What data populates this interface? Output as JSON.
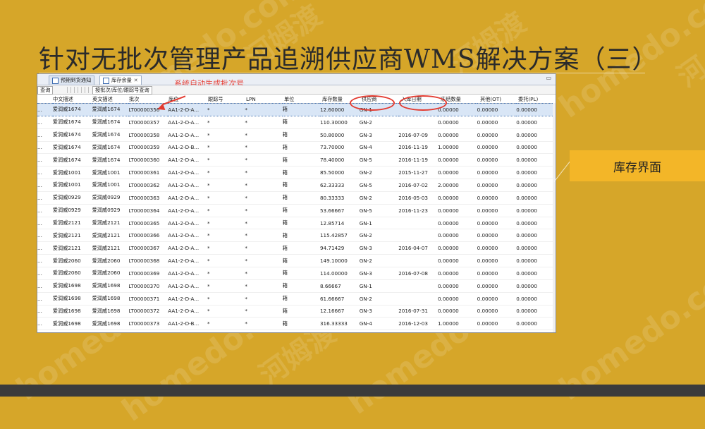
{
  "slide": {
    "title": "针对无批次管理产品追溯供应商WMS解决方案（三）",
    "callout": "库存界面",
    "annotation": "系统自动生成批次号",
    "watermarks": [
      "homedo.com",
      "河姆渡",
      "homedo.com",
      "河姆渡",
      "homedo.com",
      "homedo.com",
      "河姆渡",
      "homedo.com",
      "homedo.com",
      "河"
    ]
  },
  "window": {
    "tabs": [
      {
        "label": "预期到货通知",
        "active": false
      },
      {
        "label": "库存余量",
        "active": true
      }
    ],
    "tab_close": "✕",
    "minimize": "▭",
    "subtabs": [
      "查询",
      "按批次/库位/跟踪号查询"
    ]
  },
  "grid": {
    "columns": [
      "中文描述",
      "英文描述",
      "批次",
      "库位",
      "跟踪号",
      "LPN",
      "单位",
      "库存数量",
      "供应商",
      "入库日期",
      "冻结数量",
      "其他(OT)",
      "委托(PL)"
    ],
    "rows": [
      [
        "...",
        "爱润威1674",
        "爱润威1674",
        "LT00000356",
        "AA1-2-D-A...",
        "*",
        "*",
        "箱",
        "12.60000",
        "GN-1",
        "",
        "0.00000",
        "0.00000",
        "0.00000"
      ],
      [
        "...",
        "爱润威1674",
        "爱润威1674",
        "LT00000357",
        "AA1-2-D-A...",
        "*",
        "*",
        "箱",
        "110.30000",
        "GN-2",
        "",
        "0.00000",
        "0.00000",
        "0.00000"
      ],
      [
        "...",
        "爱润威1674",
        "爱润威1674",
        "LT00000358",
        "AA1-2-D-A...",
        "*",
        "*",
        "箱",
        "50.80000",
        "GN-3",
        "2016-07-09",
        "0.00000",
        "0.00000",
        "0.00000"
      ],
      [
        "...",
        "爱润威1674",
        "爱润威1674",
        "LT00000359",
        "AA1-2-D-B...",
        "*",
        "*",
        "箱",
        "73.70000",
        "GN-4",
        "2016-11-19",
        "1.00000",
        "0.00000",
        "0.00000"
      ],
      [
        "...",
        "爱润威1674",
        "爱润威1674",
        "LT00000360",
        "AA1-2-D-A...",
        "*",
        "*",
        "箱",
        "78.40000",
        "GN-5",
        "2016-11-19",
        "0.00000",
        "0.00000",
        "0.00000"
      ],
      [
        "...",
        "爱润威1001",
        "爱润威1001",
        "LT00000361",
        "AA1-2-D-A...",
        "*",
        "*",
        "箱",
        "85.50000",
        "GN-2",
        "2015-11-27",
        "0.00000",
        "0.00000",
        "0.00000"
      ],
      [
        "...",
        "爱润威1001",
        "爱润威1001",
        "LT00000362",
        "AA1-2-D-A...",
        "*",
        "*",
        "箱",
        "62.33333",
        "GN-5",
        "2016-07-02",
        "2.00000",
        "0.00000",
        "0.00000"
      ],
      [
        "...",
        "爱润威0929",
        "爱润威0929",
        "LT00000363",
        "AA1-2-D-A...",
        "*",
        "*",
        "箱",
        "80.33333",
        "GN-2",
        "2016-05-03",
        "0.00000",
        "0.00000",
        "0.00000"
      ],
      [
        "...",
        "爱润威0929",
        "爱润威0929",
        "LT00000364",
        "AA1-2-D-A...",
        "*",
        "*",
        "箱",
        "53.66667",
        "GN-5",
        "2016-11-23",
        "0.00000",
        "0.00000",
        "0.00000"
      ],
      [
        "...",
        "爱润威2121",
        "爱润威2121",
        "LT00000365",
        "AA1-2-D-A...",
        "*",
        "*",
        "箱",
        "12.85714",
        "GN-1",
        "",
        "0.00000",
        "0.00000",
        "0.00000"
      ],
      [
        "...",
        "爱润威2121",
        "爱润威2121",
        "LT00000366",
        "AA1-2-D-A...",
        "*",
        "*",
        "箱",
        "115.42857",
        "GN-2",
        "",
        "0.00000",
        "0.00000",
        "0.00000"
      ],
      [
        "...",
        "爱润威2121",
        "爱润威2121",
        "LT00000367",
        "AA1-2-D-A...",
        "*",
        "*",
        "箱",
        "94.71429",
        "GN-3",
        "2016-04-07",
        "0.00000",
        "0.00000",
        "0.00000"
      ],
      [
        "...",
        "爱润威2060",
        "爱润威2060",
        "LT00000368",
        "AA1-2-D-A...",
        "*",
        "*",
        "箱",
        "149.10000",
        "GN-2",
        "",
        "0.00000",
        "0.00000",
        "0.00000"
      ],
      [
        "...",
        "爱润威2060",
        "爱润威2060",
        "LT00000369",
        "AA1-2-D-A...",
        "*",
        "*",
        "箱",
        "114.00000",
        "GN-3",
        "2016-07-08",
        "0.00000",
        "0.00000",
        "0.00000"
      ],
      [
        "...",
        "爱润威1698",
        "爱润威1698",
        "LT00000370",
        "AA1-2-D-A...",
        "*",
        "*",
        "箱",
        "8.66667",
        "GN-1",
        "",
        "0.00000",
        "0.00000",
        "0.00000"
      ],
      [
        "...",
        "爱润威1698",
        "爱润威1698",
        "LT00000371",
        "AA1-2-D-A...",
        "*",
        "*",
        "箱",
        "61.66667",
        "GN-2",
        "",
        "0.00000",
        "0.00000",
        "0.00000"
      ],
      [
        "...",
        "爱润威1698",
        "爱润威1698",
        "LT00000372",
        "AA1-2-D-A...",
        "*",
        "*",
        "箱",
        "12.16667",
        "GN-3",
        "2016-07-31",
        "0.00000",
        "0.00000",
        "0.00000"
      ],
      [
        "...",
        "爱润威1698",
        "爱润威1698",
        "LT00000373",
        "AA1-2-D-B...",
        "*",
        "*",
        "箱",
        "316.33333",
        "GN-4",
        "2016-12-03",
        "1.00000",
        "0.00000",
        "0.00000"
      ]
    ],
    "selected_row": 0
  },
  "colors": {
    "background": "#d6a629",
    "callout": "#f3b628",
    "annotation_red": "#e33a2f",
    "selection": "#d9e6f6"
  }
}
